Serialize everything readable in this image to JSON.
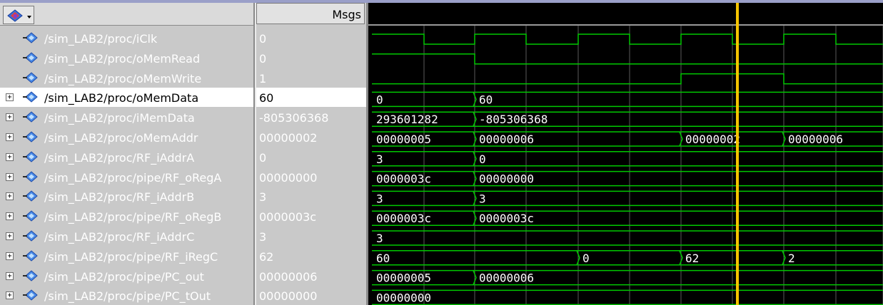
{
  "header": {
    "msgs_label": "Msgs"
  },
  "signals": [
    {
      "name": "/sim_LAB2/proc/iClk",
      "value": "0",
      "expandable": false,
      "selected": false
    },
    {
      "name": "/sim_LAB2/proc/oMemRead",
      "value": "0",
      "expandable": false,
      "selected": false
    },
    {
      "name": "/sim_LAB2/proc/oMemWrite",
      "value": "1",
      "expandable": false,
      "selected": false
    },
    {
      "name": "/sim_LAB2/proc/oMemData",
      "value": "60",
      "expandable": true,
      "selected": true
    },
    {
      "name": "/sim_LAB2/proc/iMemData",
      "value": "-805306368",
      "expandable": true,
      "selected": false
    },
    {
      "name": "/sim_LAB2/proc/oMemAddr",
      "value": "00000002",
      "expandable": true,
      "selected": false
    },
    {
      "name": "/sim_LAB2/proc/RF_iAddrA",
      "value": "0",
      "expandable": true,
      "selected": false
    },
    {
      "name": "/sim_LAB2/proc/pipe/RF_oRegA",
      "value": "00000000",
      "expandable": true,
      "selected": false
    },
    {
      "name": "/sim_LAB2/proc/RF_iAddrB",
      "value": "3",
      "expandable": true,
      "selected": false
    },
    {
      "name": "/sim_LAB2/proc/pipe/RF_oRegB",
      "value": "0000003c",
      "expandable": true,
      "selected": false
    },
    {
      "name": "/sim_LAB2/proc/RF_iAddrC",
      "value": "3",
      "expandable": true,
      "selected": false
    },
    {
      "name": "/sim_LAB2/proc/pipe/RF_iRegC",
      "value": "62",
      "expandable": true,
      "selected": false
    },
    {
      "name": "/sim_LAB2/proc/pipe/PC_out",
      "value": "00000006",
      "expandable": true,
      "selected": false
    },
    {
      "name": "/sim_LAB2/proc/pipe/PC_tOut",
      "value": "00000000",
      "expandable": true,
      "selected": false
    }
  ],
  "wave_buses": [
    [],
    [],
    [],
    [
      "0",
      "60"
    ],
    [
      "293601282",
      "-805306368"
    ],
    [
      "00000005",
      "00000006",
      "00000002",
      "00000006"
    ],
    [
      "3",
      "0"
    ],
    [
      "0000003c",
      "00000000"
    ],
    [
      "3",
      "3"
    ],
    [
      "0000003c",
      "0000003c"
    ],
    [
      "3"
    ],
    [
      "60",
      "0",
      "62",
      "2"
    ],
    [
      "00000005",
      "00000006"
    ],
    [
      "00000000"
    ]
  ],
  "colors": {
    "wave": "#00c800",
    "cursor": "#f5c400",
    "grid": "#5a5a5a",
    "pane": "#c9c9c9",
    "selected_row": "#ffffff"
  },
  "icons": {
    "signal": "blue-diamond-arrow-icon",
    "expand": "plus-box-icon",
    "toolbar": "wave-dropdown-icon"
  }
}
